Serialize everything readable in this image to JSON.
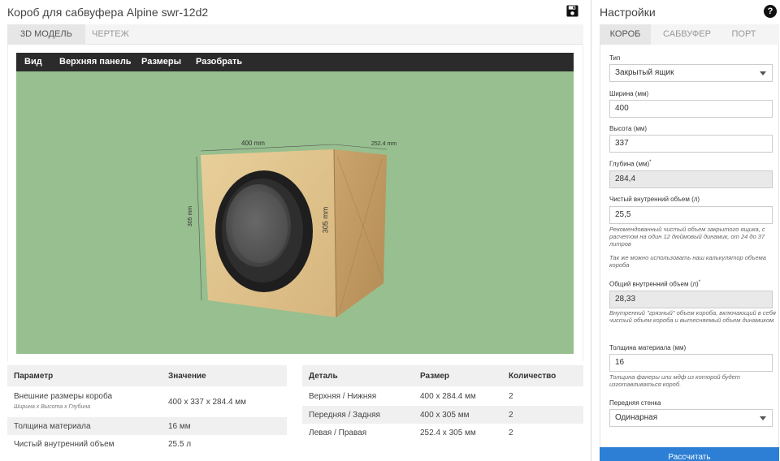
{
  "header": {
    "title": "Короб для сабвуфера Alpine swr-12d2",
    "save_icon": "save-icon"
  },
  "view_tabs": [
    {
      "label": "3D МОДЕЛЬ",
      "active": true
    },
    {
      "label": "ЧЕРТЕЖ",
      "active": false
    }
  ],
  "viewer": {
    "toolbar": [
      "Вид",
      "Верхняя панель",
      "Размеры",
      "Разобрать"
    ],
    "dims": {
      "width": "400 mm",
      "depth": "252.4 mm",
      "height_left": "305 mm",
      "height_right": "305 mm"
    },
    "background": "#97bf8f"
  },
  "params_table": {
    "headers": [
      "Параметр",
      "Значение"
    ],
    "rows": [
      {
        "name": "Внешние размеры короба",
        "sub": "Ширина х Высота х Глубина",
        "value": "400 x 337 x 284.4 мм"
      },
      {
        "name": "Толщина материала",
        "sub": "",
        "value": "16 мм"
      },
      {
        "name": "Чистый внутренний объем",
        "sub": "",
        "value": "25.5 л"
      }
    ]
  },
  "parts_table": {
    "headers": [
      "Деталь",
      "Размер",
      "Количество"
    ],
    "rows": [
      {
        "part": "Верхняя / Нижняя",
        "size": "400 x 284.4 мм",
        "qty": "2"
      },
      {
        "part": "Передняя / Задняя",
        "size": "400 x 305 мм",
        "qty": "2"
      },
      {
        "part": "Левая / Правая",
        "size": "252.4 x 305 мм",
        "qty": "2"
      }
    ]
  },
  "settings": {
    "title": "Настройки",
    "help_icon": "help-icon",
    "tabs": [
      {
        "label": "КОРОБ",
        "active": true
      },
      {
        "label": "САБВУФЕР",
        "active": false
      },
      {
        "label": "ПОРТ",
        "active": false
      }
    ],
    "fields": {
      "type": {
        "label": "Тип",
        "value": "Закрытый ящик"
      },
      "width": {
        "label": "Ширина (мм)",
        "value": "400"
      },
      "height": {
        "label": "Высота (мм)",
        "value": "337"
      },
      "depth": {
        "label": "Глубина (мм)",
        "value": "284,4"
      },
      "net_volume": {
        "label": "Чистый внутренний объем (л)",
        "value": "25,5"
      },
      "net_hint": "Рекомендованный чистый объем закрытого ящика, с расчетом на один 12 дюймовый динамик, от 24 до 37 литров",
      "calc_hint": "Так же можно использовать наш калькулятор объема короба",
      "gross_volume": {
        "label": "Общий внутренний объем (л)",
        "value": "28,33"
      },
      "gross_hint": "Внутренний \"грязный\" объем короба, включающий в себя чистый объем короба и вытесняемый объем динамиком",
      "thickness": {
        "label": "Толщина материала (мм)",
        "value": "16"
      },
      "thickness_hint": "Толщина фанеры или мдф из которой будет изготавливаться короб.",
      "front": {
        "label": "Передняя стенка",
        "value": "Одинарная"
      }
    },
    "calc_button": "Рассчитать"
  }
}
